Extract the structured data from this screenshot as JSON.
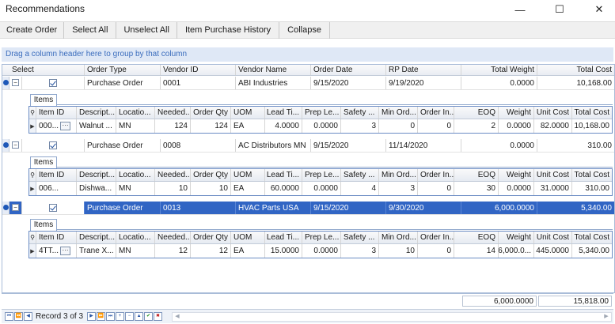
{
  "window": {
    "title": "Recommendations",
    "min_glyph": "—",
    "max_glyph": "☐",
    "close_glyph": "✕"
  },
  "toolbar": {
    "create_order": "Create Order",
    "select_all": "Select All",
    "unselect_all": "Unselect All",
    "item_history": "Item Purchase History",
    "collapse": "Collapse"
  },
  "group_hint": "Drag a column header here to group by that column",
  "columns": {
    "select": "Select",
    "order_type": "Order Type",
    "vendor_id": "Vendor ID",
    "vendor_name": "Vendor Name",
    "order_date": "Order Date",
    "rp_date": "RP Date",
    "total_weight": "Total Weight",
    "total_cost": "Total Cost"
  },
  "child_columns": {
    "tab": "Items",
    "item_id": "Item ID",
    "description": "Descript...",
    "location": "Locatio...",
    "needed": "Needed...",
    "order_qty": "Order Qty",
    "uom": "UOM",
    "lead_time": "Lead Ti...",
    "prep_lead": "Prep Le...",
    "safety": "Safety ...",
    "min_order": "Min Ord...",
    "order_inc": "Order In...",
    "eoq": "EOQ",
    "weight": "Weight",
    "unit_cost": "Unit Cost",
    "total_cost": "Total Cost"
  },
  "orders": [
    {
      "order_type": "Purchase Order",
      "vendor_id": "0001",
      "vendor_name": "ABI Industries",
      "order_date": "9/15/2020",
      "rp_date": "9/19/2020",
      "total_weight": "0.0000",
      "total_cost": "10,168.00",
      "item": {
        "item_id": "000...",
        "description": "Walnut ...",
        "location": "MN",
        "needed": "124",
        "order_qty": "124",
        "uom": "EA",
        "lead_time": "4.0000",
        "prep_lead": "0.0000",
        "safety": "3",
        "min_order": "0",
        "order_inc": "0",
        "eoq": "2",
        "weight": "0.0000",
        "unit_cost": "82.0000",
        "total_cost": "10,168.00"
      }
    },
    {
      "order_type": "Purchase Order",
      "vendor_id": "0008",
      "vendor_name": "AC Distributors MN",
      "order_date": "9/15/2020",
      "rp_date": "11/14/2020",
      "total_weight": "0.0000",
      "total_cost": "310.00",
      "item": {
        "item_id": "006...",
        "description": "Dishwa...",
        "location": "MN",
        "needed": "10",
        "order_qty": "10",
        "uom": "EA",
        "lead_time": "60.0000",
        "prep_lead": "0.0000",
        "safety": "4",
        "min_order": "3",
        "order_inc": "0",
        "eoq": "30",
        "weight": "0.0000",
        "unit_cost": "31.0000",
        "total_cost": "310.00"
      }
    },
    {
      "order_type": "Purchase Order",
      "vendor_id": "0013",
      "vendor_name": "HVAC Parts USA",
      "order_date": "9/15/2020",
      "rp_date": "9/30/2020",
      "total_weight": "6,000.0000",
      "total_cost": "5,340.00",
      "item": {
        "item_id": "4TT...",
        "description": "Trane X...",
        "location": "MN",
        "needed": "12",
        "order_qty": "12",
        "uom": "EA",
        "lead_time": "15.0000",
        "prep_lead": "0.0000",
        "safety": "3",
        "min_order": "10",
        "order_inc": "0",
        "eoq": "14",
        "weight": "6,000.0...",
        "unit_cost": "445.0000",
        "total_cost": "5,340.00"
      }
    }
  ],
  "footer": {
    "total_weight": "6,000.0000",
    "total_cost": "15,818.00"
  },
  "navigator": {
    "record_text": "Record 3 of 3"
  },
  "colors": {
    "selected_row": "#3165c4",
    "group_bar": "#dfe8f6",
    "accent": "#1e58b8"
  }
}
